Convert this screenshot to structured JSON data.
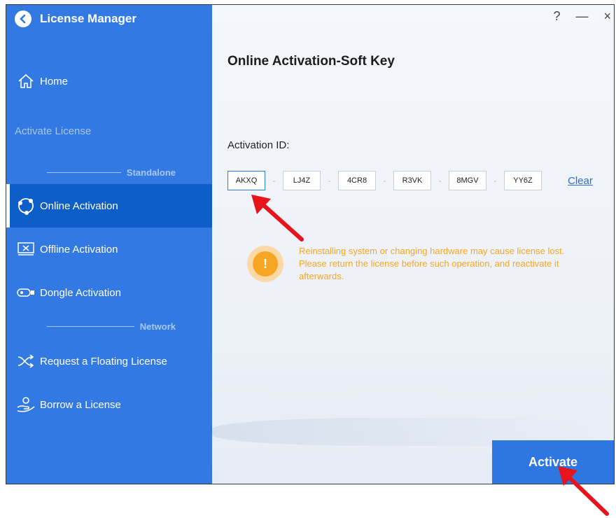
{
  "app": {
    "title": "License Manager"
  },
  "window_controls": {
    "help": "?",
    "minimize": "—",
    "close": "×"
  },
  "sidebar": {
    "home_label": "Home",
    "section_label": "Activate License",
    "group_standalone": "Standalone",
    "group_network": "Network",
    "items": [
      {
        "label": "Online Activation",
        "active": true
      },
      {
        "label": "Offline Activation"
      },
      {
        "label": "Dongle Activation"
      },
      {
        "label": "Request a Floating License"
      },
      {
        "label": "Borrow a License"
      }
    ]
  },
  "main": {
    "title": "Online Activation-Soft Key",
    "activation_label": "Activation ID:",
    "key_segments": [
      "AKXQ",
      "LJ4Z",
      "4CR8",
      "R3VK",
      "8MGV",
      "YY6Z"
    ],
    "separator": "-",
    "clear_label": "Clear",
    "warning_text": "Reinstalling system or changing hardware may cause license lost. Please return the license before such operation, and reactivate it afterwards.",
    "warning_icon": "!",
    "activate_label": "Activate"
  },
  "colors": {
    "sidebar": "#3279e3",
    "active": "#0d5ec8",
    "warning": "#f5a623",
    "annotation_arrow": "#e8141c"
  }
}
